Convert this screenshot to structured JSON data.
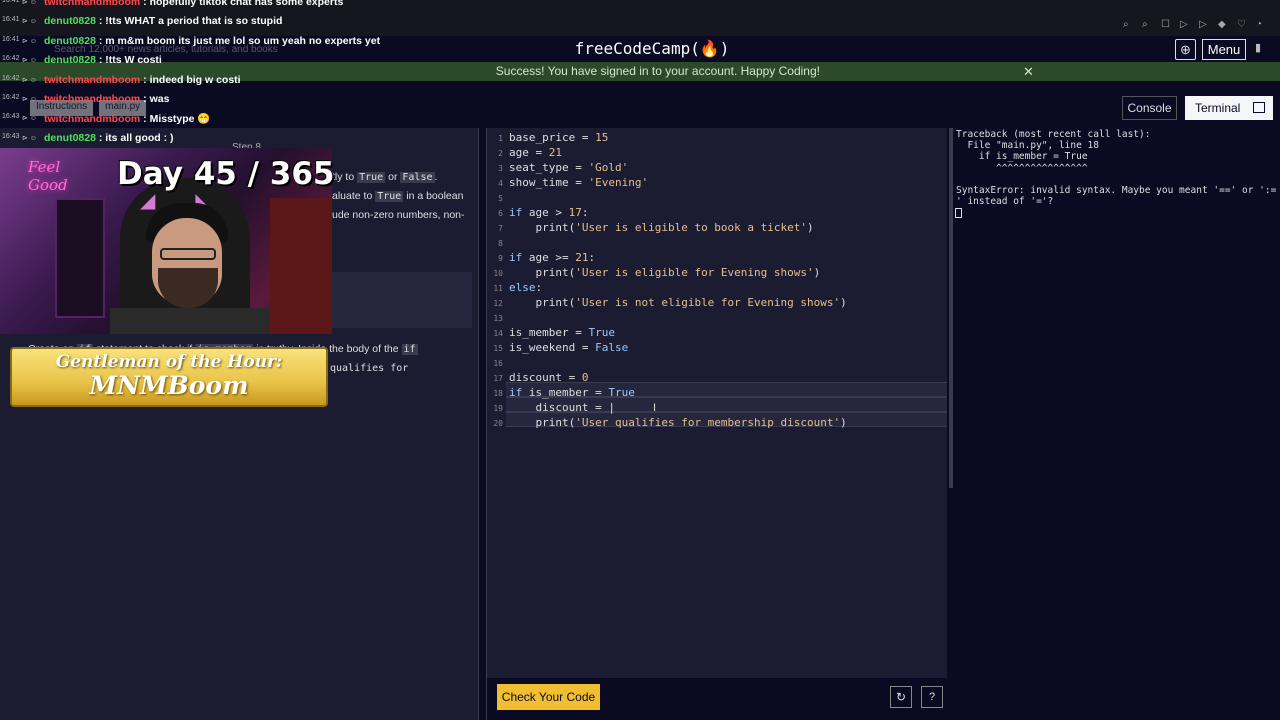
{
  "header": {
    "logo": "freeCodeCamp(🔥)",
    "menu_label": "Menu",
    "search_placeholder": "Search 12,000+ news articles, tutorials, and books"
  },
  "flash": {
    "message": "Success! You have signed in to your account. Happy Coding!"
  },
  "tabs": {
    "instructions": "Instructions",
    "main_py": "main.py"
  },
  "step_label": "Step 8",
  "panel_buttons": {
    "console": "Console",
    "terminal": "Terminal"
  },
  "description": {
    "line1_prefix": "tly to",
    "true_code": "True",
    "or": "or",
    "false_code": "False",
    "line1_end": ".",
    "line2_prefix": "aluate to",
    "line2_code": "True",
    "line2_suffix": "in a boolean",
    "line3": "ude non-zero numbers, non-"
  },
  "task": {
    "part1": "Create an",
    "code1": "if",
    "part2": "statement to check if",
    "code2": "is_member",
    "part3": "is truthy. Inside the body of the",
    "code3": "if",
    "line2_code": "qualifies for"
  },
  "editor": {
    "lines": [
      {
        "num": "1",
        "tokens": [
          {
            "t": "base_price = ",
            "c": "n"
          },
          {
            "t": "15",
            "c": "s"
          }
        ]
      },
      {
        "num": "2",
        "tokens": [
          {
            "t": "age = ",
            "c": "n"
          },
          {
            "t": "21",
            "c": "s"
          }
        ]
      },
      {
        "num": "3",
        "tokens": [
          {
            "t": "seat_type = ",
            "c": "n"
          },
          {
            "t": "'Gold'",
            "c": "s"
          }
        ]
      },
      {
        "num": "4",
        "tokens": [
          {
            "t": "show_time = ",
            "c": "n"
          },
          {
            "t": "'Evening'",
            "c": "s"
          }
        ]
      },
      {
        "num": "5",
        "tokens": []
      },
      {
        "num": "6",
        "tokens": [
          {
            "t": "if",
            "c": "k"
          },
          {
            "t": " age > ",
            "c": "n"
          },
          {
            "t": "17",
            "c": "s"
          },
          {
            "t": ":",
            "c": "n"
          }
        ]
      },
      {
        "num": "7",
        "tokens": [
          {
            "t": "    print(",
            "c": "n"
          },
          {
            "t": "'User is eligible to book a ticket'",
            "c": "s"
          },
          {
            "t": ")",
            "c": "n"
          }
        ]
      },
      {
        "num": "8",
        "tokens": []
      },
      {
        "num": "9",
        "tokens": [
          {
            "t": "if",
            "c": "k"
          },
          {
            "t": " age >= ",
            "c": "n"
          },
          {
            "t": "21",
            "c": "s"
          },
          {
            "t": ":",
            "c": "n"
          }
        ]
      },
      {
        "num": "10",
        "tokens": [
          {
            "t": "    print(",
            "c": "n"
          },
          {
            "t": "'User is eligible for Evening shows'",
            "c": "s"
          },
          {
            "t": ")",
            "c": "n"
          }
        ]
      },
      {
        "num": "11",
        "tokens": [
          {
            "t": "else",
            "c": "k"
          },
          {
            "t": ":",
            "c": "n"
          }
        ]
      },
      {
        "num": "12",
        "tokens": [
          {
            "t": "    print(",
            "c": "n"
          },
          {
            "t": "'User is not eligible for Evening shows'",
            "c": "s"
          },
          {
            "t": ")",
            "c": "n"
          }
        ]
      },
      {
        "num": "13",
        "tokens": []
      },
      {
        "num": "14",
        "tokens": [
          {
            "t": "is_member = ",
            "c": "n"
          },
          {
            "t": "True",
            "c": "b"
          }
        ]
      },
      {
        "num": "15",
        "tokens": [
          {
            "t": "is_weekend = ",
            "c": "n"
          },
          {
            "t": "False",
            "c": "b"
          }
        ]
      },
      {
        "num": "16",
        "tokens": []
      },
      {
        "num": "17",
        "tokens": [
          {
            "t": "discount = ",
            "c": "n"
          },
          {
            "t": "0",
            "c": "s"
          }
        ]
      },
      {
        "num": "18",
        "tokens": [
          {
            "t": "if",
            "c": "k"
          },
          {
            "t": " is_member = ",
            "c": "n"
          },
          {
            "t": "True",
            "c": "b"
          }
        ]
      },
      {
        "num": "19",
        "tokens": [
          {
            "t": "    discount = |",
            "c": "n"
          }
        ]
      },
      {
        "num": "20",
        "tokens": [
          {
            "t": "    print(",
            "c": "n"
          },
          {
            "t": "'User qualifies for membership discount'",
            "c": "s"
          },
          {
            "t": ")",
            "c": "n"
          }
        ]
      }
    ]
  },
  "terminal": {
    "lines": [
      "Traceback (most recent call last):",
      "  File \"main.py\", line 18",
      "    if is_member = True",
      "       ^^^^^^^^^^^^^^^^",
      "SyntaxError: invalid syntax. Maybe you meant '==' or ':=",
      "' instead of '='?"
    ]
  },
  "bottom": {
    "check_button": "Check Your Code"
  },
  "stream": {
    "day_counter": "Day 45 / 365",
    "neon_sign": "Feel Good",
    "gentleman_title": "Gentleman of the Hour:",
    "gentleman_name": "MNMBoom",
    "chat": [
      {
        "time": "16:41",
        "name": "twitchmandmboom",
        "color": "red",
        "text": ": hopefully tiktok chat has some experts"
      },
      {
        "time": "16:41",
        "name": "denut0828",
        "color": "green",
        "text": ": !tts WHAT a period that is so stupid"
      },
      {
        "time": "16:41",
        "name": "denut0828",
        "color": "green",
        "text": ": m m&m boom its just me lol so um yeah no experts yet"
      },
      {
        "time": "16:42",
        "name": "denut0828",
        "color": "green",
        "text": ": !tts W costi"
      },
      {
        "time": "16:42",
        "name": "twitchmandmboom",
        "color": "red",
        "text": ": indeed big w costi"
      },
      {
        "time": "16:42",
        "name": "twitchmandmboom",
        "color": "red",
        "text": ": was"
      },
      {
        "time": "16:43",
        "name": "twitchmandmboom",
        "color": "red",
        "text": ": Misstype 😁"
      },
      {
        "time": "16:43",
        "name": "denut0828",
        "color": "green",
        "text": ": its all good : )"
      }
    ]
  },
  "colors": {
    "background": "#0a0a23",
    "panel": "#1b1b32",
    "accent_yellow": "#f1be32",
    "keyword_blue": "#99c9ff",
    "string_tan": "#e2c08d"
  }
}
